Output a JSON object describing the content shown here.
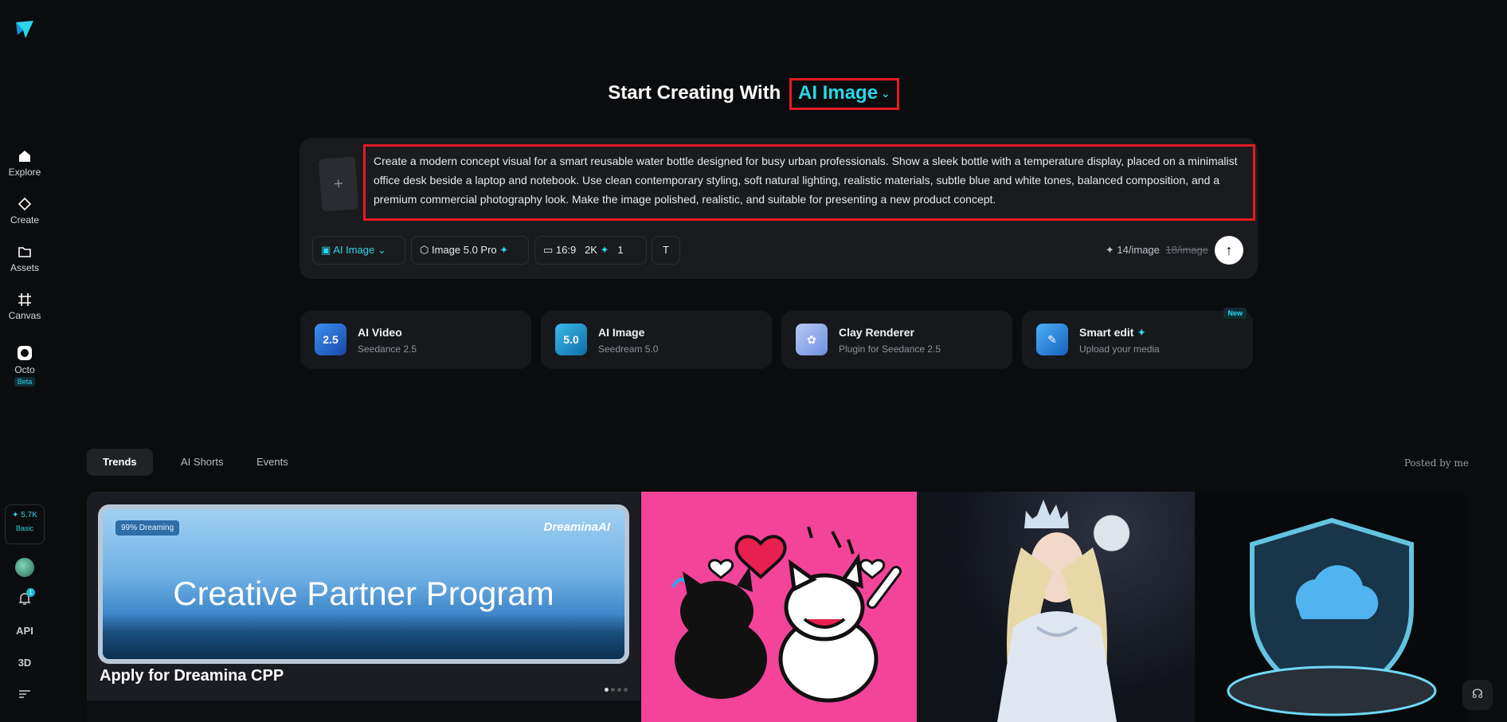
{
  "sidebar": {
    "nav": [
      {
        "label": "Explore",
        "icon": "home-icon"
      },
      {
        "label": "Create",
        "icon": "diamond-icon"
      },
      {
        "label": "Assets",
        "icon": "folder-icon"
      },
      {
        "label": "Canvas",
        "icon": "canvas-icon"
      },
      {
        "label": "Octo",
        "icon": "octo-icon",
        "badge": "Beta"
      }
    ],
    "credits": {
      "amount": "5.7K",
      "tier": "Basic"
    },
    "notifications_count": "1",
    "api_label": "API",
    "three_d_label": "3D"
  },
  "headline": {
    "prefix": "Start Creating With",
    "mode": "AI Image"
  },
  "prompt": {
    "upload_symbol": "+",
    "text": "Create a modern concept visual for a smart reusable water bottle designed for busy urban professionals. Show a sleek bottle with a temperature display, placed on a minimalist office desk beside a laptop and notebook. Use clean contemporary styling, soft natural lighting, realistic materials, subtle blue and white tones, balanced composition, and a premium commercial photography look. Make the image polished, realistic, and suitable for presenting a new product concept.",
    "toolbar": {
      "mode": "AI Image",
      "model": "Image 5.0 Pro",
      "ratio": "16:9",
      "resolution": "2K",
      "count": "1"
    },
    "price": "14/image",
    "old_price": "18/image",
    "send_symbol": "↑"
  },
  "features": [
    {
      "title": "AI Video",
      "subtitle": "Seedance 2.5",
      "icon_text": "2.5",
      "color": "#1f6fd6"
    },
    {
      "title": "AI Image",
      "subtitle": "Seedream 5.0",
      "icon_text": "5.0",
      "color": "#1593c9"
    },
    {
      "title": "Clay Renderer",
      "subtitle": "Plugin for Seedance 2.5",
      "icon_text": "✿",
      "color": "#8aa6e8"
    },
    {
      "title": "Smart edit",
      "subtitle": "Upload your media",
      "icon_text": "✎",
      "color": "#1d7fe0",
      "badge": "New"
    }
  ],
  "tabs": [
    {
      "label": "Trends",
      "active": true
    },
    {
      "label": "AI Shorts",
      "active": false
    },
    {
      "label": "Events",
      "active": false
    }
  ],
  "posted_by": "Posted by me",
  "gallery": {
    "banner": {
      "pill": "99% Dreaming",
      "brand": "DreaminaAI",
      "headline": "Creative Partner Program",
      "caption": "Apply for Dreamina CPP"
    }
  },
  "colors": {
    "accent": "#2ad6e8",
    "highlight_border": "#e31b23",
    "background": "#0b0c0e"
  }
}
